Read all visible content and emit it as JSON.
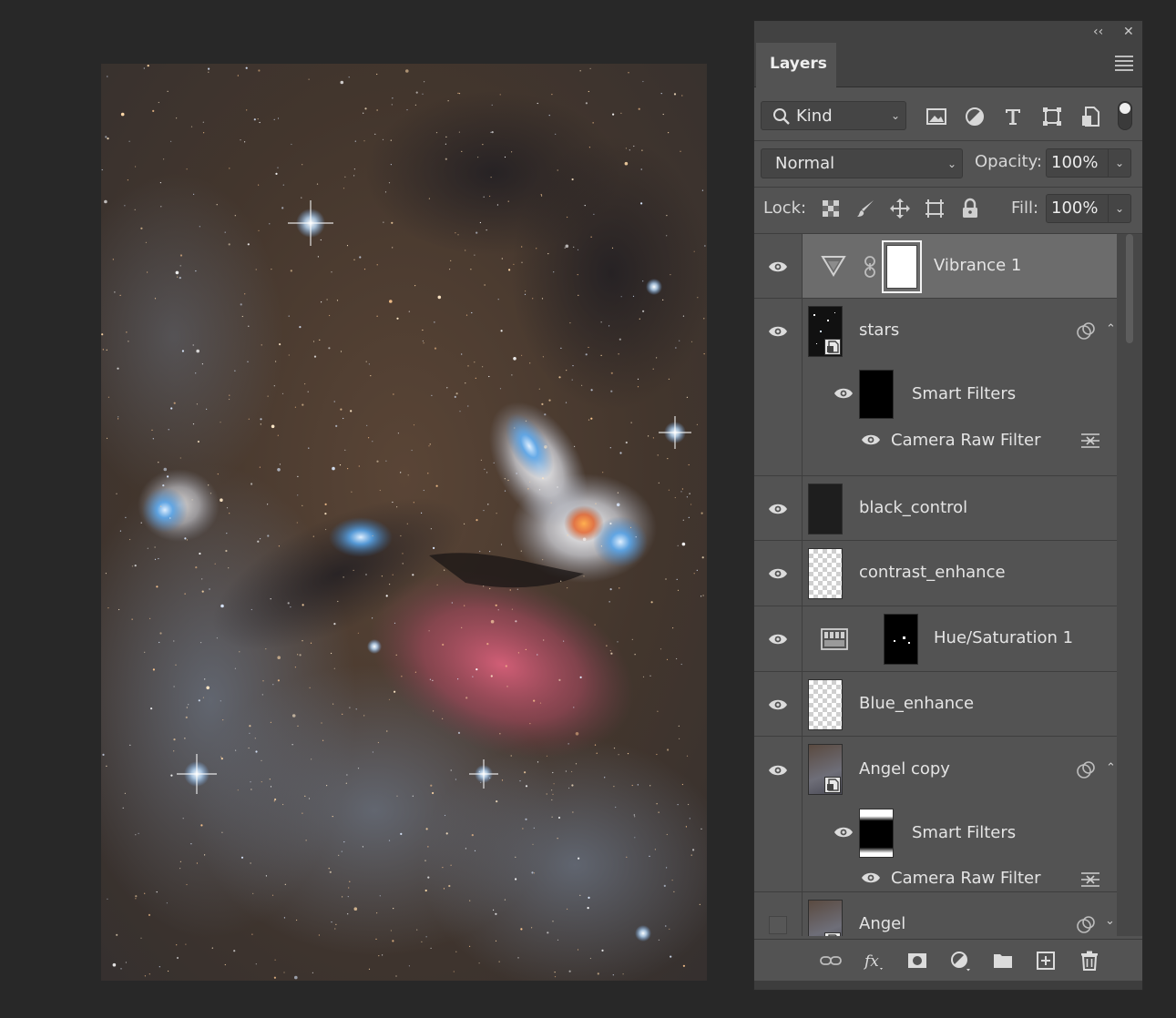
{
  "panel": {
    "tab_label": "Layers",
    "collapse_label": "‹‹",
    "close_label": "✕",
    "filter": {
      "kind_label": "Kind"
    },
    "blend": {
      "mode": "Normal",
      "opacity_label": "Opacity:",
      "opacity_value": "100%"
    },
    "lock": {
      "label": "Lock:",
      "fill_label": "Fill:",
      "fill_value": "100%"
    }
  },
  "layers": [
    {
      "name": "Vibrance 1",
      "visible": true,
      "selected": true,
      "type": "adjustment",
      "adjustment_icon": "vibrance-icon",
      "mask": "white"
    },
    {
      "name": "stars",
      "visible": true,
      "type": "smart-object",
      "expanded": true,
      "smart_filters_label": "Smart Filters",
      "filter_name": "Camera Raw Filter"
    },
    {
      "name": "black_control",
      "visible": true,
      "type": "fill-black"
    },
    {
      "name": "contrast_enhance",
      "visible": true,
      "type": "transparent"
    },
    {
      "name": "Hue/Saturation 1",
      "visible": true,
      "type": "adjustment",
      "adjustment_icon": "hue-saturation-icon",
      "mask": "black-specks"
    },
    {
      "name": "Blue_enhance",
      "visible": true,
      "type": "transparent"
    },
    {
      "name": "Angel copy",
      "visible": true,
      "type": "smart-object",
      "expanded": true,
      "smart_filters_label": "Smart Filters",
      "filter_name": "Camera Raw Filter"
    },
    {
      "name": "Angel",
      "visible": false,
      "type": "smart-object",
      "expanded": false
    }
  ],
  "colors": {
    "panel_bg": "#535353",
    "selected_row": "#6c6c6c",
    "app_bg": "#282828"
  }
}
